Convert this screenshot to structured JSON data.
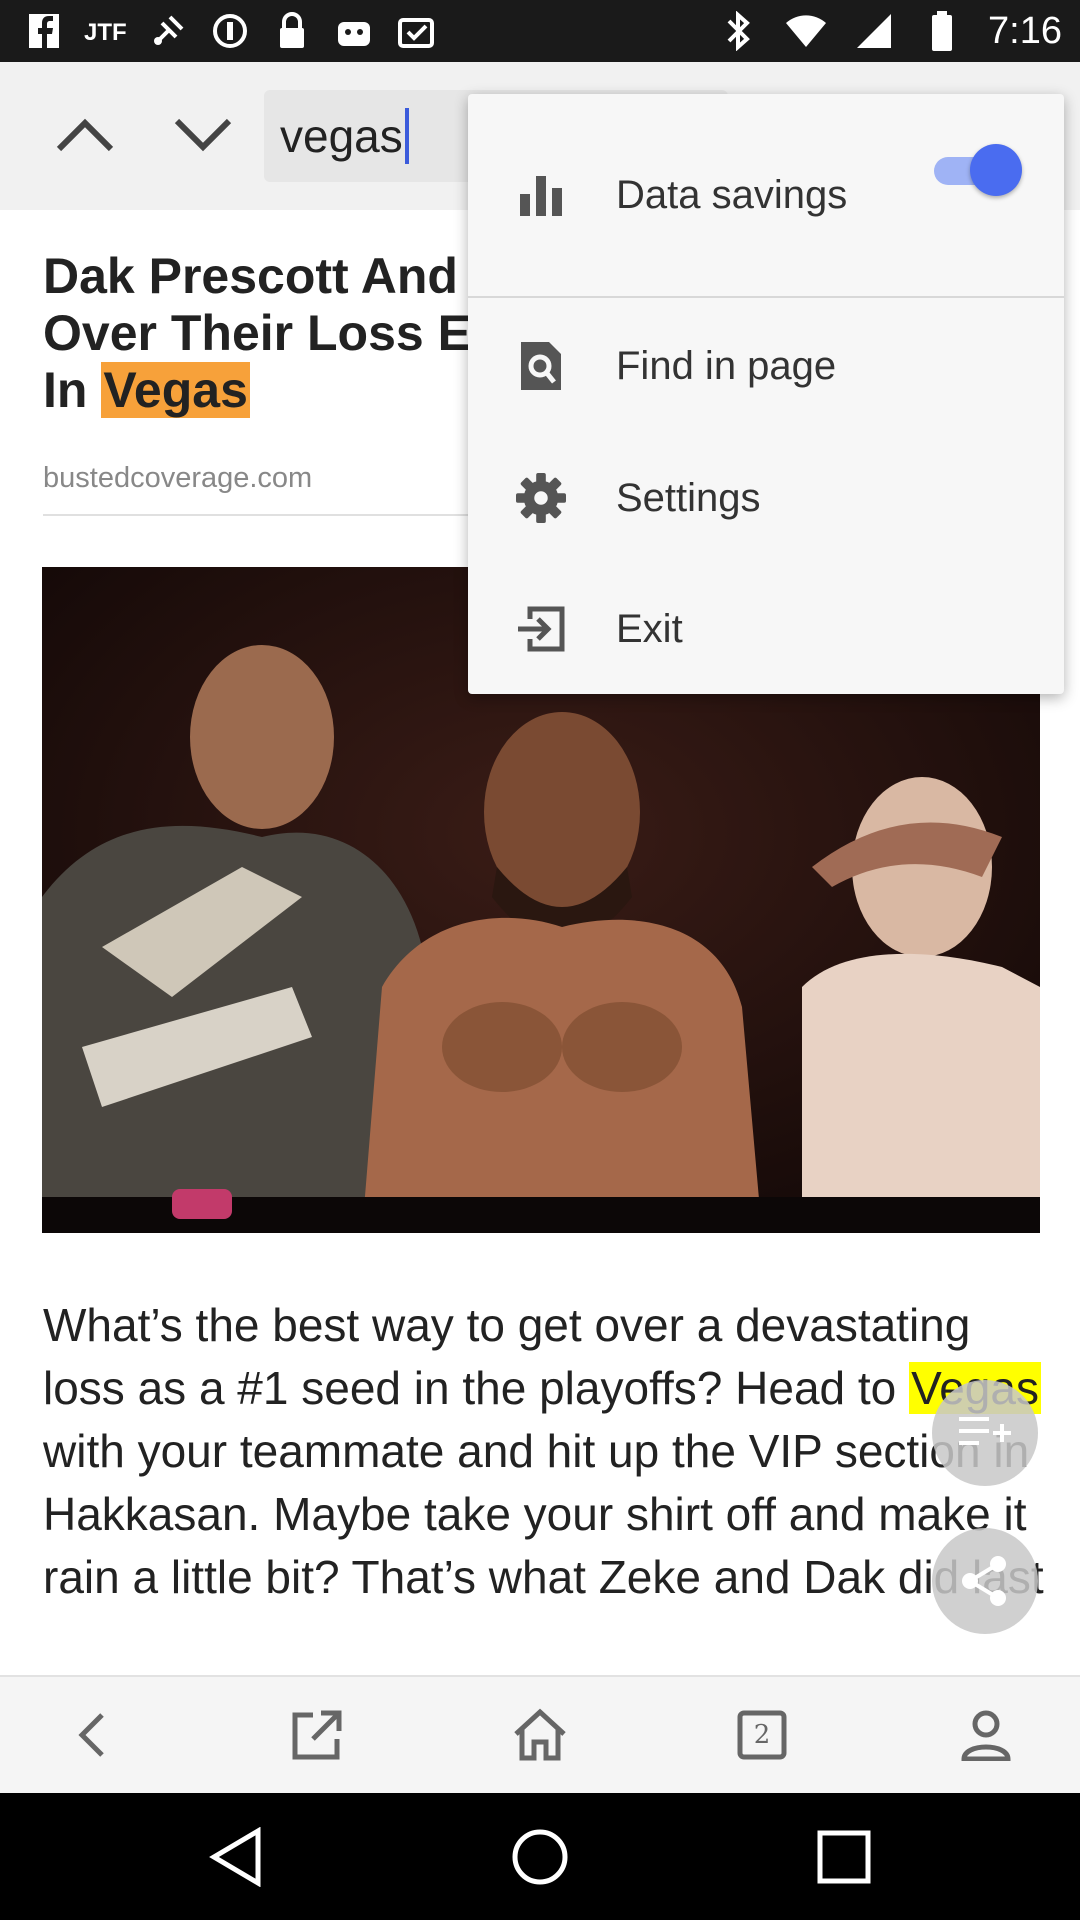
{
  "status_bar": {
    "time": "7:16",
    "left_icons": [
      "facebook-icon",
      "jio-icon",
      "fake-gps-icon",
      "data-saver-icon",
      "lock-icon",
      "android-icon",
      "clipboard-check-icon"
    ],
    "right_icons": [
      "bluetooth-icon",
      "wifi-icon",
      "signal-icon",
      "battery-icon"
    ]
  },
  "find_bar": {
    "query": "vegas"
  },
  "article": {
    "headline_lines": [
      "Dak Prescott And",
      "Over Their Loss E",
      "In "
    ],
    "headline_highlight": "Vegas",
    "source": "bustedcoverage.com",
    "body_parts": {
      "before": "What’s the best way to get over a devastating loss as a #1 seed in the playoffs? Head to ",
      "highlight": "Vegas",
      "after": " with your teammate and hit up the VIP section in Hakkasan. Maybe take your shirt off and make it rain a little bit? That’s what Zeke and Dak did last"
    }
  },
  "menu": {
    "items": [
      {
        "label": "Data savings",
        "icon": "bar-chart-icon",
        "toggle_on": true
      },
      {
        "label": "Find in page",
        "icon": "find-in-page-icon"
      },
      {
        "label": "Settings",
        "icon": "gear-icon"
      },
      {
        "label": "Exit",
        "icon": "exit-icon"
      }
    ]
  },
  "toolbar": {
    "tab_count": "2",
    "icons": [
      "back-icon",
      "open-external-icon",
      "home-icon",
      "tabs-icon",
      "profile-icon"
    ]
  },
  "colors": {
    "accent": "#4a6cf0",
    "headline_highlight": "#f7a13a",
    "body_highlight": "#ffff00"
  }
}
